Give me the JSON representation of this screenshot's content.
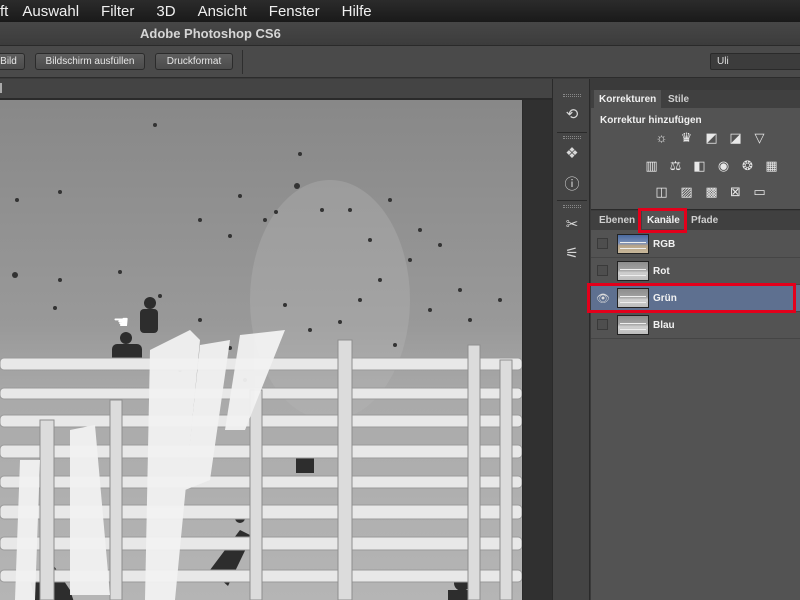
{
  "menubar": {
    "items": [
      "ft",
      "Auswahl",
      "Filter",
      "3D",
      "Ansicht",
      "Fenster",
      "Hilfe"
    ]
  },
  "window": {
    "title": "Adobe Photoshop CS6"
  },
  "options_bar": {
    "bild": "Bild",
    "fill_screen": "Bildschirm ausfüllen",
    "print_size": "Druckformat",
    "workspace": "Uli"
  },
  "dock": {
    "collapse_arrows": "◂◂",
    "icons": [
      "history-icon",
      "3d-icon",
      "info-icon",
      "tools-preset-icon",
      "brush-settings-icon"
    ]
  },
  "adjustments": {
    "tabs": [
      "Korrekturen",
      "Stile"
    ],
    "heading": "Korrektur hinzufügen"
  },
  "channels": {
    "tabs": [
      "Ebenen",
      "Kanäle",
      "Pfade"
    ],
    "rows": [
      {
        "name": "RGB",
        "visible": false,
        "selected": false,
        "thumb": "color"
      },
      {
        "name": "Rot",
        "visible": false,
        "selected": false,
        "thumb": "gray"
      },
      {
        "name": "Grün",
        "visible": true,
        "selected": true,
        "thumb": "gray"
      },
      {
        "name": "Blau",
        "visible": false,
        "selected": false,
        "thumb": "gray"
      }
    ]
  },
  "colors": {
    "highlight": "#e3001b",
    "selection": "#5e7090",
    "panel": "#535353"
  }
}
